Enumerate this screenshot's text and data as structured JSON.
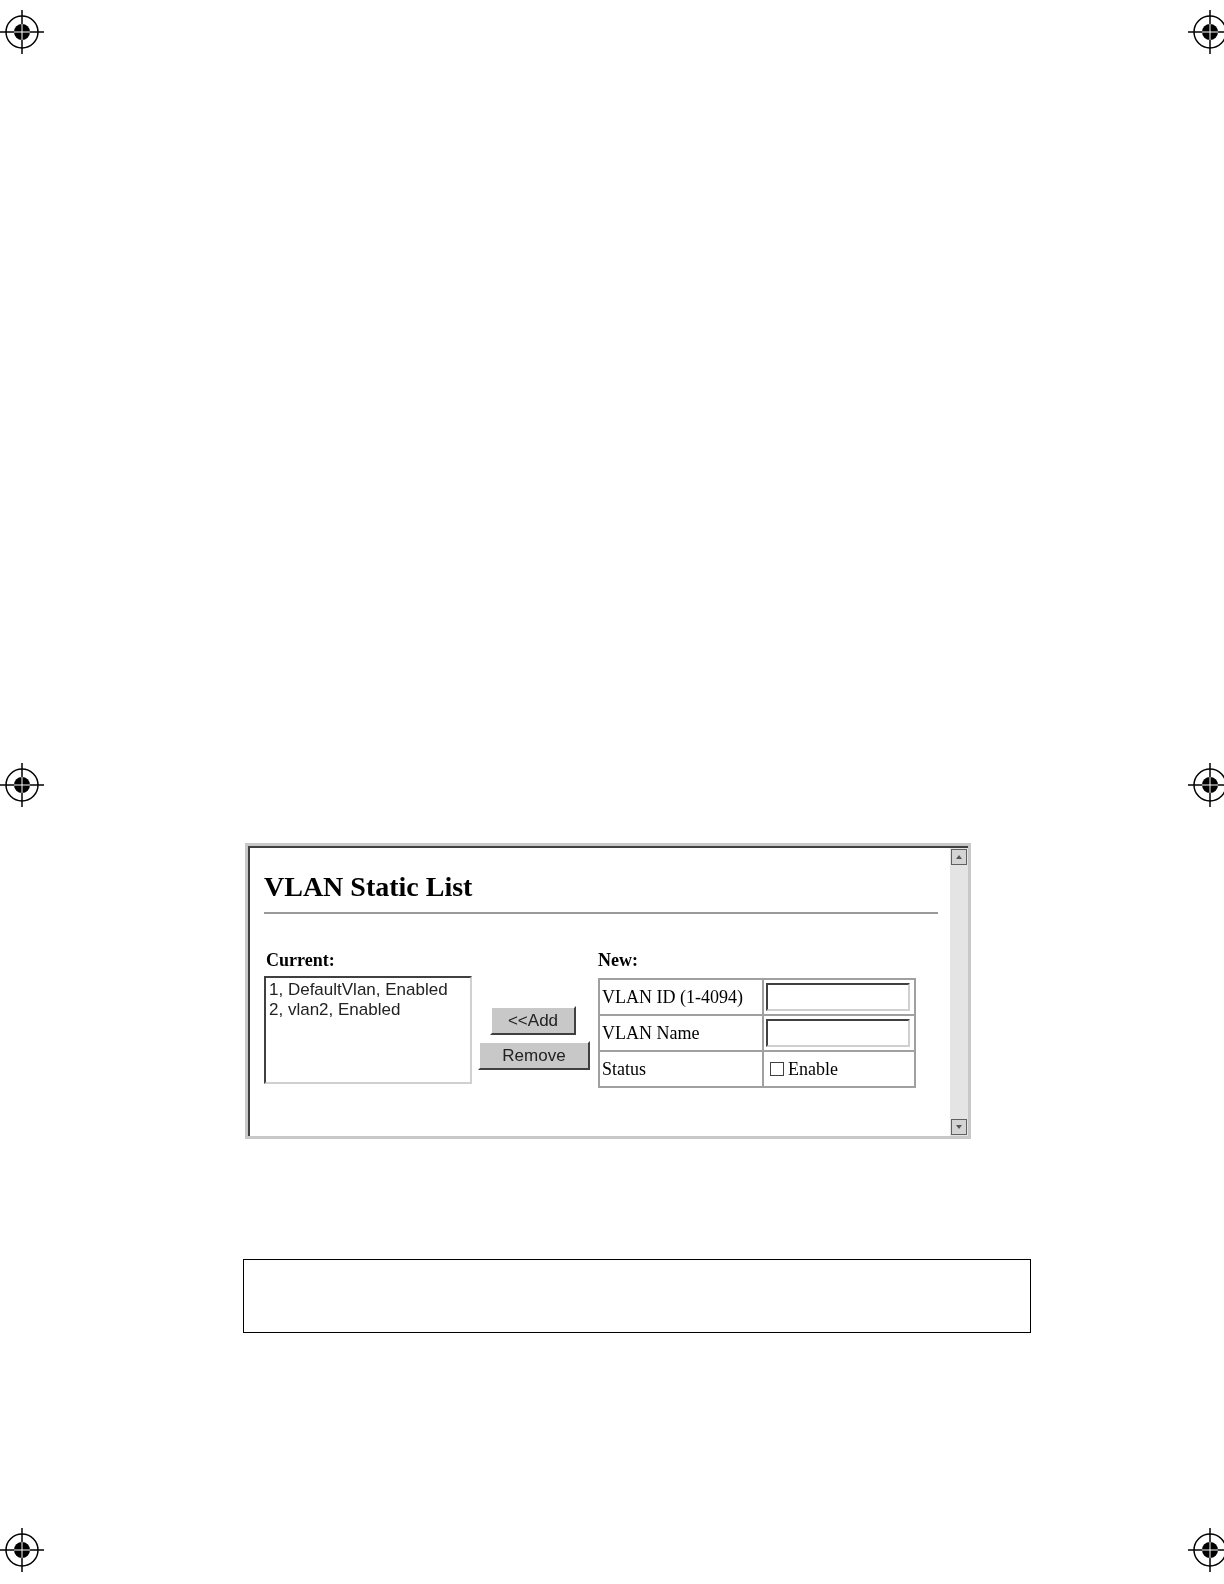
{
  "window": {
    "title": "VLAN Static List"
  },
  "current": {
    "label": "Current:",
    "items": [
      {
        "text": "1, DefaultVlan, Enabled",
        "selected": false
      },
      {
        "text": "2, vlan2, Enabled",
        "selected": false
      }
    ]
  },
  "buttons": [
    {
      "label": "<<Add"
    },
    {
      "label": "Remove"
    }
  ],
  "new": {
    "label": "New:",
    "fields": [
      {
        "kind": "input",
        "label": "VLAN ID (1-4094)"
      },
      {
        "kind": "input",
        "label": "VLAN Name"
      },
      {
        "kind": "checkbox",
        "label": "Status",
        "option": "Enable",
        "checked": false
      }
    ]
  }
}
